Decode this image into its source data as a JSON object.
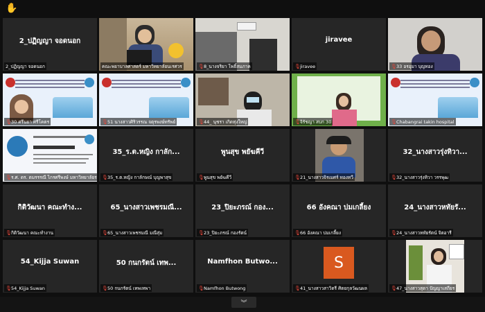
{
  "meeting": {
    "raised_hand_icon": "hand-icon",
    "expand_icon": "chevron-down-icon"
  },
  "tiles": [
    {
      "center": "2_ปฏิญญา จอดนอก",
      "label": "2_ปฏิญญา จอดนอก",
      "type": "name",
      "mic_muted": false
    },
    {
      "center": "",
      "label": "คณะพยาบาลศาสตร์ มหาวิทยาลัยนเรศวร",
      "type": "video-office",
      "mic_muted": false,
      "active": true
    },
    {
      "center": "",
      "label": "8_นางจริยา โพธิ์สมภาค",
      "type": "video-room",
      "mic_muted": true
    },
    {
      "center": "jiravee",
      "label": "jiravee",
      "type": "name",
      "mic_muted": true
    },
    {
      "center": "",
      "label": "33 อรอุมา บุญทอง",
      "type": "video-person",
      "mic_muted": true
    },
    {
      "center": "",
      "label": "30 ศรีนยา ศรีโคตร",
      "type": "slide-face",
      "mic_muted": true
    },
    {
      "center": "",
      "label": "51 นางสาวศิริวรรณ จตุรพงษ์ทรัพย์",
      "type": "slide",
      "mic_muted": true
    },
    {
      "center": "",
      "label": "44_ นุชรา เกิดทุ่งใหญ่",
      "type": "video-desk",
      "mic_muted": true
    },
    {
      "center": "",
      "label": "จิรัชญา สบก 30",
      "type": "video-board",
      "mic_muted": true
    },
    {
      "center": "",
      "label": "Chabangrai takin hospital",
      "type": "slide",
      "mic_muted": true
    },
    {
      "center": "",
      "label": "ร.ศ. ดร. ตมรรรณี ไกรศรีพงษ์ มหาวิทยาลัยราชภัฏราชนครินทร์",
      "type": "slide-talk",
      "mic_muted": true
    },
    {
      "center": "35_ร.ต.หญิง กาลัก...",
      "label": "35_ร.ต.หญิง กาลักษณ์ บุญพาสุข",
      "type": "name",
      "mic_muted": true
    },
    {
      "center": "พูนสุข พยัฆคีวี",
      "label": "พูนสุข พยัฆคีวี",
      "type": "name",
      "mic_muted": true
    },
    {
      "center": "",
      "label": "21_นางสาวจิรเมศร์ ทองทวี",
      "type": "video-kid",
      "mic_muted": true
    },
    {
      "center": "32_นางสาวรุ่งทิวา...",
      "label": "32_นางสาวรุ่งทิวา วรรพุฒ",
      "type": "name",
      "mic_muted": true
    },
    {
      "center": "กิติวัฒนา คณะทำง...",
      "label": "กิติวัฒนา คณะทำงาน",
      "type": "name",
      "mic_muted": true
    },
    {
      "center": "65_นางสาวเพชรมณี...",
      "label": "65_นางสาวเพชรมณี มณีสุ่ม",
      "type": "name",
      "mic_muted": true
    },
    {
      "center": "23_ปิยะภรณ์ กอง...",
      "label": "23_ปิยะภรณ์ กองรัตน์",
      "type": "name",
      "mic_muted": true
    },
    {
      "center": "66 อังคณา บ่มเกลี้ยง",
      "label": "66 อังคณา บ่มเกลี้ยง",
      "type": "name",
      "mic_muted": true
    },
    {
      "center": "24_นางสาวหทัยรั...",
      "label": "24_นางสาวหทัยรัตน์ จิตอารี",
      "type": "name",
      "mic_muted": true
    },
    {
      "center": "54_Kijja Suwan",
      "label": "54_Kijja Suwan",
      "type": "name",
      "mic_muted": true
    },
    {
      "center": "50 กนกรัตน์ เทพ...",
      "label": "50 กนกรัตน์ เทพเทพา",
      "type": "name",
      "mic_muted": true
    },
    {
      "center": "Namfhon Butwo...",
      "label": "Namfhon Butwong",
      "type": "name",
      "mic_muted": true
    },
    {
      "center": "S",
      "label": "41_นางสาวสาวิตรี ศิตยกุลวัฒนผล",
      "type": "avatar",
      "mic_muted": true
    },
    {
      "center": "",
      "label": "47_นางสาวสุดา ปัญญาเสถียร",
      "type": "video-woman",
      "mic_muted": true
    }
  ],
  "colors": {
    "tile_bg": "#262626",
    "active_border": "#9cc43a",
    "muted_mic": "#e0463a",
    "avatar_bg": "#d9591f"
  }
}
